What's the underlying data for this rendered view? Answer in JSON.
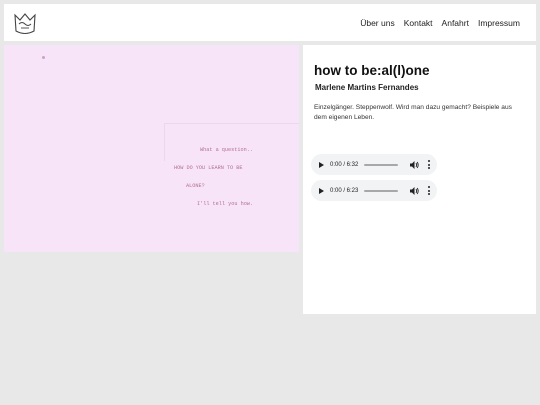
{
  "nav": {
    "items": [
      "Über uns",
      "Kontakt",
      "Anfahrt",
      "Impressum"
    ]
  },
  "image": {
    "typed_lines": [
      "What a question..",
      "HOW DO YOU LEARN TO BE",
      "ALONE?",
      "I'll tell you how."
    ]
  },
  "article": {
    "title": "how to be:al(l)one",
    "author": "Marlene Martins Fernandes",
    "description": "Einzelgänger. Steppenwolf. Wird man dazu gemacht? Beispiele aus dem eigenen Leben."
  },
  "audio": [
    {
      "time": "0:00 / 6:32"
    },
    {
      "time": "0:00 / 6:23"
    }
  ],
  "icons": {
    "logo": "logo-icon",
    "play": "play-icon",
    "volume": "volume-icon",
    "menu": "more-vert-icon"
  },
  "colors": {
    "background": "#e8e8e8",
    "panel": "#ffffff",
    "image_tint": "#f8e4f8",
    "typewriter_ink": "#b07090",
    "player_bg": "#f1f3f4"
  }
}
